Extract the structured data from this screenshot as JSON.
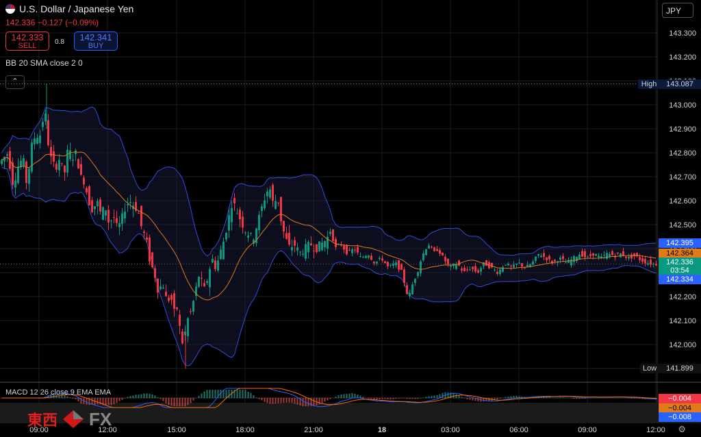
{
  "header": {
    "title": "U.S. Dollar / Japanese Yen",
    "price_line": "142.336  −0.127 (−0.09%)",
    "sell_price": "142.333",
    "sell_label": "SELL",
    "buy_price": "142.341",
    "buy_label": "BUY",
    "spread": "0.8",
    "indicator_label": "BB 20 SMA close 2 0",
    "collapse_icon": "⌃",
    "currency": "JPY"
  },
  "macd": {
    "label": "MACD 12 26 close 9 EMA EMA"
  },
  "branding": {
    "cjk": "東西",
    "fx": "FX"
  },
  "colors": {
    "bg": "#000000",
    "up": "#089981",
    "down": "#f23645",
    "band": "#2f4ee0",
    "sma": "#e07b1a",
    "accent": "#2962ff"
  },
  "chart_data": {
    "type": "candlestick",
    "title": "U.S. Dollar / Japanese Yen",
    "ylim": [
      141.9,
      143.25
    ],
    "yticks": [
      "143.300",
      "143.200",
      "143.100",
      "143.000",
      "142.900",
      "142.800",
      "142.700",
      "142.600",
      "142.500",
      "142.400",
      "142.300",
      "142.200",
      "142.100",
      "142.000",
      "141.900"
    ],
    "xticks": [
      "09:00",
      "12:00",
      "15:00",
      "18:00",
      "21:00",
      "18",
      "03:00",
      "06:00",
      "09:00",
      "12:00"
    ],
    "high_label": "High",
    "high_value": "143.087",
    "low_label": "Low",
    "low_value": "141.899",
    "last_price": "142.336",
    "countdown": "03:54",
    "bb_upper": "142.395",
    "bb_basis": "142.364",
    "bb_lower": "142.334",
    "macd_values": [
      "−0.004",
      "−0.004",
      "−0.008"
    ],
    "close_path": [
      [
        0,
        142.75
      ],
      [
        14,
        142.8
      ],
      [
        22,
        142.66
      ],
      [
        28,
        142.74
      ],
      [
        36,
        142.78
      ],
      [
        42,
        142.66
      ],
      [
        48,
        142.82
      ],
      [
        55,
        142.88
      ],
      [
        60,
        142.86
      ],
      [
        64,
        142.92
      ],
      [
        68,
        142.98
      ],
      [
        73,
        142.84
      ],
      [
        78,
        142.76
      ],
      [
        84,
        142.74
      ],
      [
        90,
        142.78
      ],
      [
        96,
        142.7
      ],
      [
        102,
        142.82
      ],
      [
        108,
        142.78
      ],
      [
        114,
        142.8
      ],
      [
        120,
        142.7
      ],
      [
        126,
        142.68
      ],
      [
        132,
        142.6
      ],
      [
        138,
        142.56
      ],
      [
        144,
        142.6
      ],
      [
        150,
        142.54
      ],
      [
        156,
        142.58
      ],
      [
        162,
        142.5
      ],
      [
        168,
        142.54
      ],
      [
        174,
        142.48
      ],
      [
        180,
        142.52
      ],
      [
        186,
        142.58
      ],
      [
        192,
        142.6
      ],
      [
        198,
        142.58
      ],
      [
        204,
        142.56
      ],
      [
        210,
        142.48
      ],
      [
        216,
        142.44
      ],
      [
        222,
        142.34
      ],
      [
        228,
        142.3
      ],
      [
        234,
        142.22
      ],
      [
        240,
        142.26
      ],
      [
        246,
        142.18
      ],
      [
        252,
        142.2
      ],
      [
        258,
        142.12
      ],
      [
        262,
        142.16
      ],
      [
        266,
        142.04
      ],
      [
        270,
        142.0
      ],
      [
        276,
        142.1
      ],
      [
        282,
        142.14
      ],
      [
        288,
        142.22
      ],
      [
        294,
        142.3
      ],
      [
        300,
        142.22
      ],
      [
        306,
        142.28
      ],
      [
        312,
        142.36
      ],
      [
        318,
        142.32
      ],
      [
        324,
        142.38
      ],
      [
        330,
        142.44
      ],
      [
        336,
        142.52
      ],
      [
        342,
        142.6
      ],
      [
        348,
        142.56
      ],
      [
        354,
        142.52
      ],
      [
        360,
        142.48
      ],
      [
        366,
        142.46
      ],
      [
        372,
        142.44
      ],
      [
        378,
        142.5
      ],
      [
        384,
        142.56
      ],
      [
        390,
        142.62
      ],
      [
        396,
        142.66
      ],
      [
        402,
        142.58
      ],
      [
        408,
        142.62
      ],
      [
        414,
        142.5
      ],
      [
        420,
        142.44
      ],
      [
        426,
        142.4
      ],
      [
        432,
        142.42
      ],
      [
        440,
        142.38
      ],
      [
        448,
        142.4
      ],
      [
        456,
        142.42
      ],
      [
        464,
        142.4
      ],
      [
        472,
        142.42
      ],
      [
        480,
        142.44
      ],
      [
        486,
        142.48
      ],
      [
        492,
        142.4
      ],
      [
        500,
        142.42
      ],
      [
        510,
        142.38
      ],
      [
        520,
        142.4
      ],
      [
        530,
        142.36
      ],
      [
        540,
        142.38
      ],
      [
        550,
        142.34
      ],
      [
        560,
        142.36
      ],
      [
        570,
        142.32
      ],
      [
        580,
        142.34
      ],
      [
        590,
        142.3
      ],
      [
        596,
        142.22
      ],
      [
        600,
        142.2
      ],
      [
        606,
        142.26
      ],
      [
        612,
        142.3
      ],
      [
        618,
        142.36
      ],
      [
        624,
        142.4
      ],
      [
        630,
        142.42
      ],
      [
        636,
        142.38
      ],
      [
        642,
        142.4
      ],
      [
        650,
        142.36
      ],
      [
        660,
        142.32
      ],
      [
        670,
        142.34
      ],
      [
        680,
        142.3
      ],
      [
        690,
        142.32
      ],
      [
        700,
        142.3
      ],
      [
        710,
        142.34
      ],
      [
        720,
        142.32
      ],
      [
        730,
        142.3
      ],
      [
        740,
        142.34
      ],
      [
        750,
        142.32
      ],
      [
        760,
        142.34
      ],
      [
        770,
        142.32
      ],
      [
        780,
        142.34
      ],
      [
        790,
        142.38
      ],
      [
        800,
        142.36
      ],
      [
        810,
        142.34
      ],
      [
        820,
        142.36
      ],
      [
        830,
        142.34
      ],
      [
        840,
        142.36
      ],
      [
        850,
        142.38
      ],
      [
        860,
        142.36
      ],
      [
        870,
        142.38
      ],
      [
        880,
        142.36
      ],
      [
        890,
        142.38
      ],
      [
        900,
        142.37
      ],
      [
        910,
        142.38
      ],
      [
        920,
        142.36
      ],
      [
        930,
        142.37
      ],
      [
        940,
        142.35
      ],
      [
        950,
        142.34
      ],
      [
        958,
        142.336
      ]
    ]
  }
}
